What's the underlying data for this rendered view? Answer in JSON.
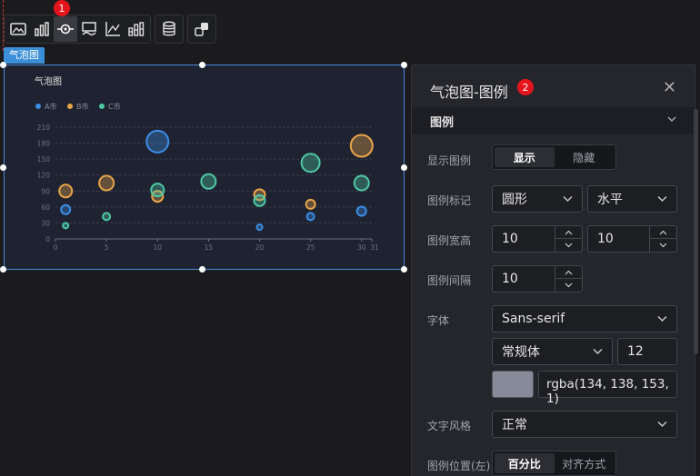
{
  "toolbar": {
    "items": [
      {
        "icon": "image-icon"
      },
      {
        "icon": "bar-chart-icon"
      },
      {
        "icon": "bubble-chart-icon",
        "active": true
      },
      {
        "icon": "area-map-icon"
      },
      {
        "icon": "axis-line-icon"
      },
      {
        "icon": "stacked-bar-icon"
      },
      {
        "icon": "database-icon"
      },
      {
        "icon": "link-swap-icon"
      }
    ],
    "badge": "1"
  },
  "chart_tag": "气泡图",
  "chart_data": {
    "type": "scatter",
    "title": "气泡图",
    "legend_position": "top-left",
    "xlim": [
      0,
      31
    ],
    "ylim": [
      0,
      210
    ],
    "x_ticks": [
      "0",
      "5",
      "10",
      "15",
      "20",
      "25",
      "30",
      "31"
    ],
    "y_ticks": [
      "0",
      "30",
      "60",
      "90",
      "120",
      "150",
      "180",
      "210"
    ],
    "grid": true,
    "series": [
      {
        "name": "A市",
        "color": "#3b8ee8",
        "points": [
          [
            1,
            55,
            5
          ],
          [
            10,
            183,
            12
          ],
          [
            20,
            22,
            3
          ],
          [
            25,
            42,
            4
          ],
          [
            30,
            52,
            5
          ]
        ]
      },
      {
        "name": "B市",
        "color": "#e8a54a",
        "points": [
          [
            1,
            90,
            7
          ],
          [
            5,
            105,
            8
          ],
          [
            10,
            80,
            6
          ],
          [
            20,
            83,
            6
          ],
          [
            25,
            65,
            5
          ],
          [
            30,
            175,
            12
          ]
        ]
      },
      {
        "name": "C市",
        "color": "#4ec9a6",
        "points": [
          [
            1,
            25,
            3
          ],
          [
            5,
            42,
            4
          ],
          [
            10,
            92,
            7
          ],
          [
            15,
            108,
            8
          ],
          [
            20,
            72,
            6
          ],
          [
            25,
            143,
            10
          ],
          [
            30,
            105,
            8
          ]
        ]
      }
    ]
  },
  "panel": {
    "title": "气泡图-图例",
    "badge": "2",
    "section": "图例",
    "show_legend_label": "显示图例",
    "show_option": "显示",
    "hide_option": "隐藏",
    "marker_label": "图例标记",
    "marker_shape": "圆形",
    "marker_orient": "水平",
    "size_label": "图例宽高",
    "width_value": "10",
    "height_value": "10",
    "gap_label": "图例间隔",
    "gap_value": "10",
    "font_label": "字体",
    "font_family": "Sans-serif",
    "font_weight": "常规体",
    "font_size": "12",
    "font_color": "rgba(134, 138, 153, 1)",
    "text_style_label": "文字风格",
    "text_style": "正常",
    "position_label": "图例位置(左)",
    "percent_option": "百分比",
    "align_option": "对齐方式"
  }
}
